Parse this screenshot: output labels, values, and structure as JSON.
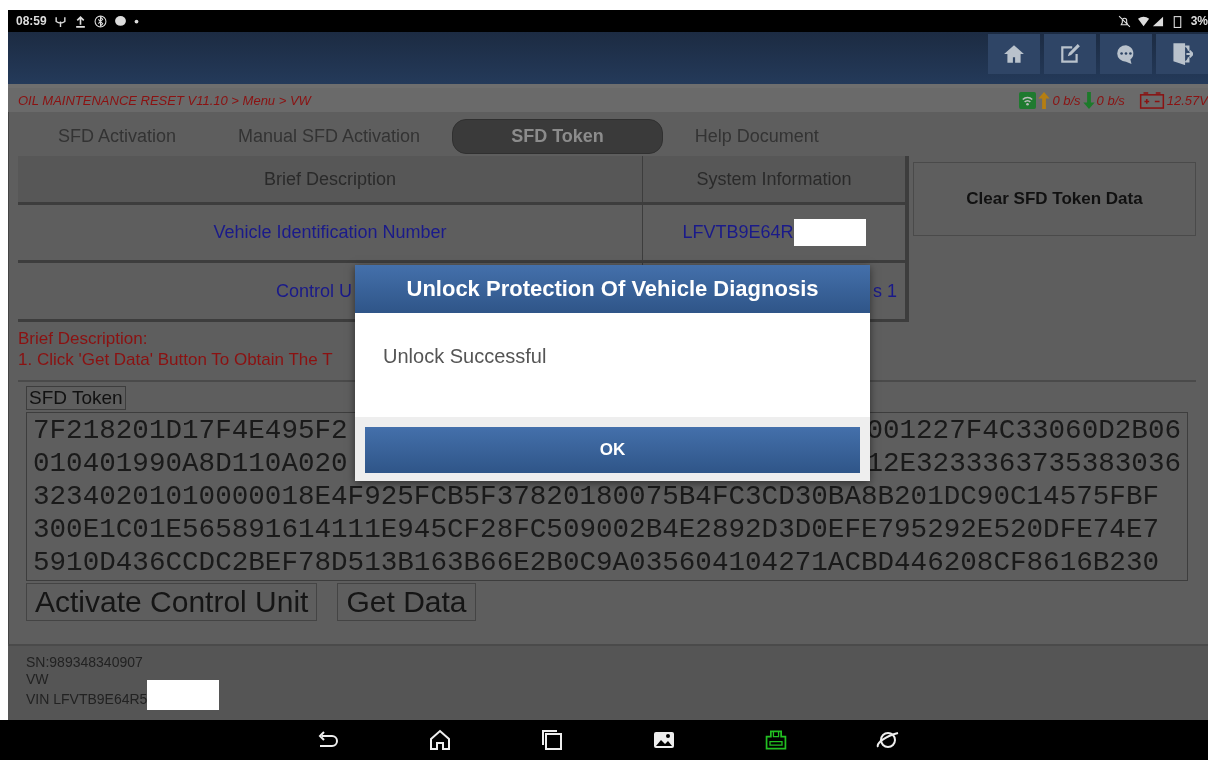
{
  "status_bar": {
    "time": "08:59",
    "battery": "3%"
  },
  "breadcrumb": {
    "path": "OIL MAINTENANCE RESET V11.10 > Menu > VW",
    "upload": "0 b/s",
    "download": "0 b/s",
    "voltage": "12.57V"
  },
  "tabs": [
    {
      "label": "SFD Activation",
      "selected": false
    },
    {
      "label": "Manual SFD Activation",
      "selected": false
    },
    {
      "label": "SFD Token",
      "selected": true
    },
    {
      "label": "Help Document",
      "selected": false
    }
  ],
  "table": {
    "columns": [
      "Brief Description",
      "System Information"
    ],
    "rows": [
      {
        "cells": [
          {
            "text": "Vehicle Identification Number"
          },
          {
            "text": "LFVTB9E64R",
            "redacted": true
          }
        ]
      },
      {
        "cells": [
          {
            "text": "Control U"
          },
          {
            "text": "s 1"
          }
        ]
      }
    ]
  },
  "side_button": "Clear SFD Token Data",
  "instructions": [
    "Brief Description:",
    "1. Click 'Get Data' Button To Obtain The T"
  ],
  "token": {
    "label": "SFD Token",
    "lines": [
      {
        "left": "7F218201D17F4E495F2",
        "right": "001227F4C33060D2B06"
      },
      {
        "left": "010401990A8D110A020",
        "right": "12E3233363735383036"
      },
      {
        "left": "32340201010000018E4F925FCB5F37820180075B4FC3CD30BA8B201DC90C14575FBF"
      },
      {
        "left": "300E1C01E565891614111E945CF28FC509002B4E2892D3D0EFE795292E520DFE74E7"
      },
      {
        "left": "5910D436CCDC2BEF78D513B163B66E2B0C9A035604104271ACBD446208CF8616B230"
      }
    ]
  },
  "actions": [
    "Activate Control Unit",
    "Get Data"
  ],
  "footer": {
    "sn": "SN:989348340907",
    "make": "VW",
    "vin": "VIN LFVTB9E64R5",
    "vin_redacted": true
  },
  "dialog": {
    "title": "Unlock Protection Of Vehicle Diagnosis",
    "message": "Unlock Successful",
    "button": "OK"
  }
}
